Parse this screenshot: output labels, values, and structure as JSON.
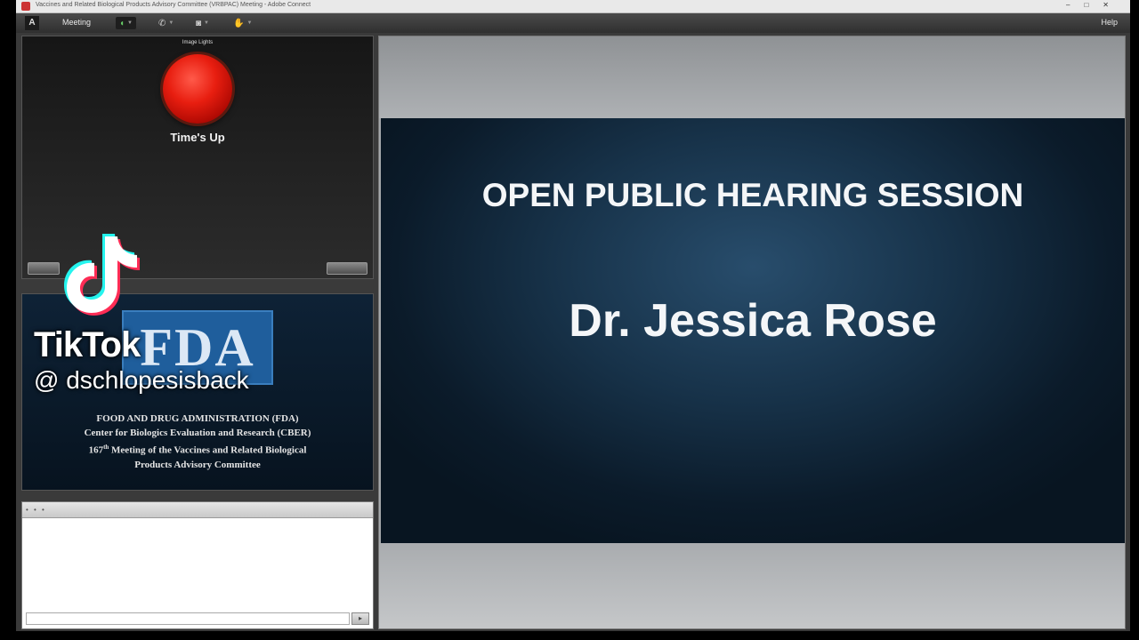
{
  "window": {
    "title": "Vaccines and Related Biological Products Advisory Committee (VRBPAC) Meeting - Adobe Connect"
  },
  "menubar": {
    "logo": "A",
    "meeting_label": "Meeting",
    "help_label": "Help"
  },
  "timer_pod": {
    "header": "Image Lights",
    "status": "Time's Up"
  },
  "fda_pod": {
    "logo_text": "FDA",
    "line1": "FOOD AND DRUG ADMINISTRATION (FDA)",
    "line2": "Center for Biologics Evaluation and Research (CBER)",
    "line3_num": "167",
    "line3_sup": "th",
    "line3_rest": " Meeting of the Vaccines and Related Biological",
    "line4": "Products Advisory Committee"
  },
  "chat_pod": {
    "header": "• • •",
    "send_label": "▸"
  },
  "slide": {
    "title": "OPEN PUBLIC HEARING SESSION",
    "speaker": "Dr. Jessica Rose"
  },
  "overlay": {
    "brand": "TikTok",
    "handle": "@ dschlopesisback"
  },
  "colors": {
    "slide_bg": "#173249",
    "timer_red": "#e81e10",
    "fda_blue": "#1f5e9c",
    "stage_gray": "#a5a8ab"
  }
}
